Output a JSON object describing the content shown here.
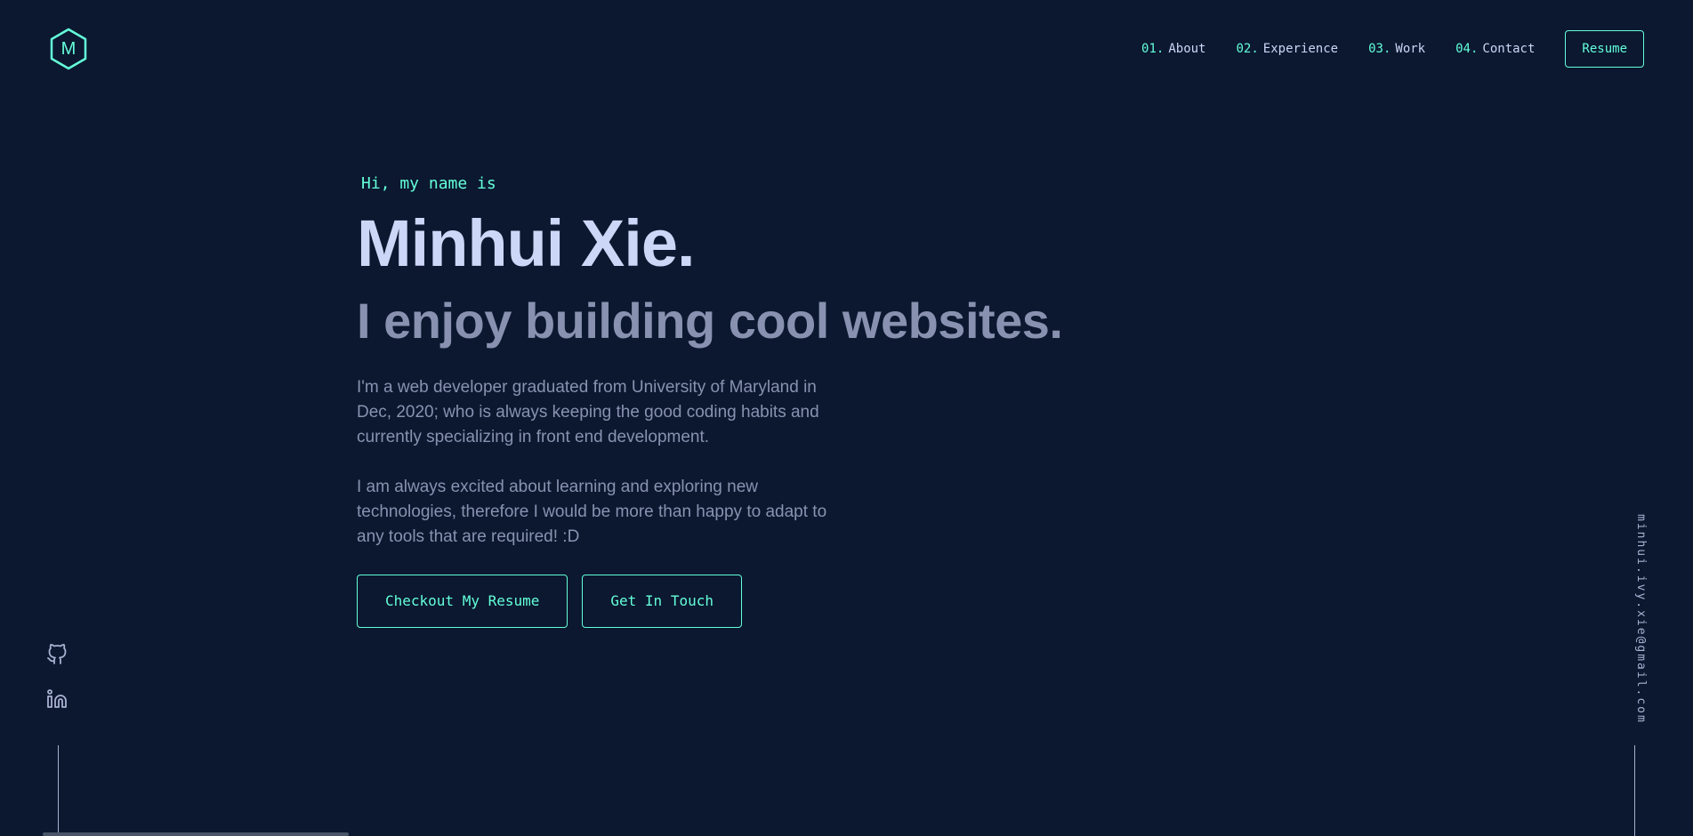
{
  "logo": {
    "letter": "M"
  },
  "nav": {
    "items": [
      {
        "num": "01.",
        "label": "About"
      },
      {
        "num": "02.",
        "label": "Experience"
      },
      {
        "num": "03.",
        "label": "Work"
      },
      {
        "num": "04.",
        "label": "Contact"
      }
    ],
    "resume_label": "Resume"
  },
  "hero": {
    "greeting": "Hi, my name is",
    "name": "Minhui Xie.",
    "tagline": "I enjoy building cool websites.",
    "bio": [
      "I'm a web developer graduated from University of Maryland in Dec, 2020; who is always keeping the good coding habits and currently specializing in front end development.",
      "I am always excited about learning and exploring new technologies, therefore I would be more than happy to adapt to any tools that are required! :D"
    ],
    "cta_resume": "Checkout My Resume",
    "cta_contact": "Get In Touch"
  },
  "social": [
    {
      "icon": "github-icon"
    },
    {
      "icon": "linkedin-icon"
    }
  ],
  "email": "minhui.ivy.xie@gmail.com",
  "colors": {
    "background": "#0b1830",
    "accent": "#64ffda",
    "heading": "#ccd6f6",
    "body_text": "#8892b0"
  }
}
